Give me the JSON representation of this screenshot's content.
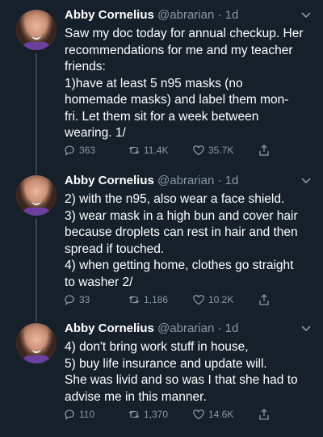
{
  "tweets": [
    {
      "author_name": "Abby Cornelius",
      "handle": "@abrarian",
      "time": "1d",
      "lines": [
        "Saw my doc today for annual checkup. Her",
        "recommendations for me and my teacher",
        "friends:",
        "1)have at least 5 n95 masks (no",
        "homemade masks) and label them mon-",
        "fri. Let them sit for a week between",
        "wearing. 1/"
      ],
      "replies": "363",
      "retweets": "11.4K",
      "likes": "35.7K"
    },
    {
      "author_name": "Abby Cornelius",
      "handle": "@abrarian",
      "time": "1d",
      "lines": [
        "2) with the n95, also wear a face shield.",
        "3) wear mask in a high bun and cover hair",
        "because droplets can rest in hair and then",
        "spread if touched.",
        "4) when getting home, clothes go straight",
        "to washer 2/"
      ],
      "replies": "33",
      "retweets": "1,186",
      "likes": "10.2K"
    },
    {
      "author_name": "Abby Cornelius",
      "handle": "@abrarian",
      "time": "1d",
      "lines": [
        "4) don't bring work stuff in house,",
        "5) buy life insurance and update will.",
        "She was livid and so was I that she had to",
        "advise me in this manner."
      ],
      "replies": "110",
      "retweets": "1,370",
      "likes": "14.6K"
    }
  ],
  "icons": {
    "reply": "reply-icon",
    "retweet": "retweet-icon",
    "like": "heart-icon",
    "share": "share-icon",
    "menu": "chevron-down-icon"
  },
  "colors": {
    "background": "#15202b",
    "text": "#ffffff",
    "muted": "#8899a6",
    "thread_line": "#38444d"
  }
}
